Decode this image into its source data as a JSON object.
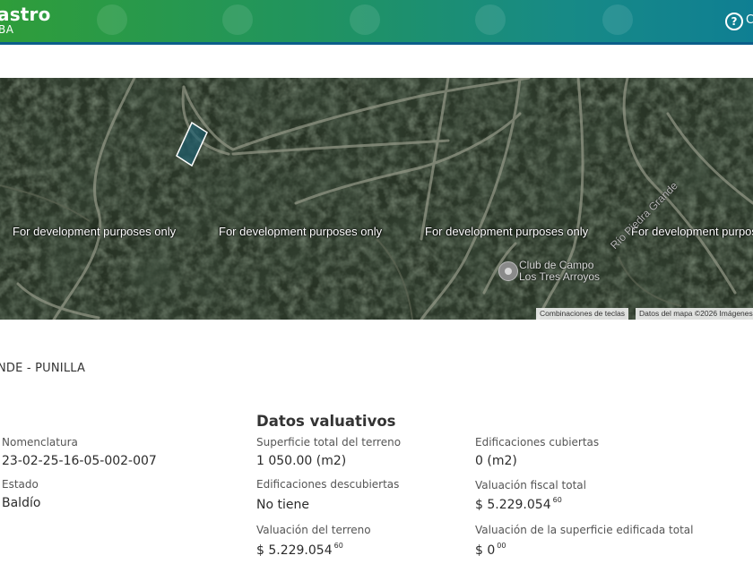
{
  "header": {
    "brand_title": "astro",
    "brand_subtitle": "BA",
    "help_label": "C",
    "colors": {
      "gradient_start": "#2f9d3a",
      "gradient_end": "#0f7f93"
    }
  },
  "map": {
    "watermark": "For development purposes only",
    "poi_name_line1": "Club de Campo",
    "poi_name_line2": "Los Tres Arroyos",
    "river_label": "Río Piedra Grande",
    "attribution_shortcuts": "Combinaciones de teclas",
    "attribution_data": "Datos del mapa ©2026 Imágenes"
  },
  "location": {
    "text": "NDE - PUNILLA"
  },
  "parcel": {
    "nomenclatura_label": "Nomenclatura",
    "nomenclatura_value": "23-02-25-16-05-002-007",
    "estado_label": "Estado",
    "estado_value": "Baldío"
  },
  "valuation": {
    "title": "Datos valuativos",
    "superficie_label": "Superficie total del terreno",
    "superficie_value": "1 050.00 (m2)",
    "edif_descubiertas_label": "Edificaciones descubiertas",
    "edif_descubiertas_value": "No tiene",
    "valuacion_terreno_label": "Valuación del terreno",
    "valuacion_terreno_value": "$ 5.229.054",
    "valuacion_terreno_cents": "60",
    "edif_cubiertas_label": "Edificaciones cubiertas",
    "edif_cubiertas_value": "0 (m2)",
    "valuacion_fiscal_label": "Valuación fiscal total",
    "valuacion_fiscal_value": "$ 5.229.054",
    "valuacion_fiscal_cents": "60",
    "valuacion_edificada_label": "Valuación de la superficie edificada total",
    "valuacion_edificada_value": "$ 0",
    "valuacion_edificada_cents": "00"
  }
}
